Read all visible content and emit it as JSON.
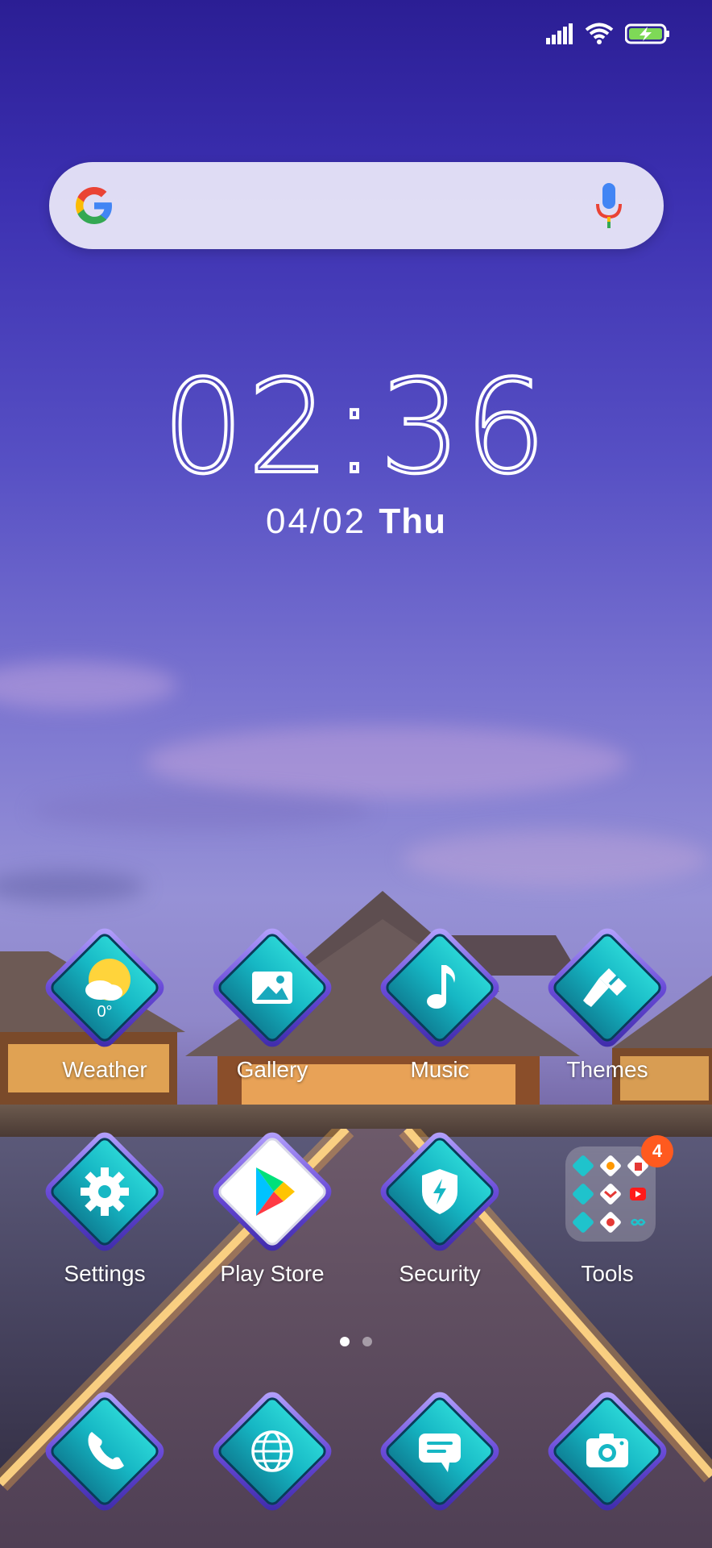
{
  "status_bar": {
    "signal_icon": "signal-icon",
    "wifi_icon": "wifi-icon",
    "battery_icon": "battery-charging-icon",
    "battery_color": "#7ed957"
  },
  "search": {
    "logo_icon": "google-g-icon",
    "mic_icon": "microphone-icon"
  },
  "clock": {
    "time": "02:36",
    "date": "04/02",
    "weekday": "Thu"
  },
  "apps": {
    "weather": {
      "label": "Weather",
      "temp": "0°"
    },
    "gallery": {
      "label": "Gallery"
    },
    "music": {
      "label": "Music"
    },
    "themes": {
      "label": "Themes"
    },
    "settings": {
      "label": "Settings"
    },
    "play_store": {
      "label": "Play Store"
    },
    "security": {
      "label": "Security"
    },
    "tools": {
      "label": "Tools",
      "badge": "4"
    }
  },
  "page_indicator": {
    "pages": 2,
    "current": 1
  },
  "dock": {
    "items": [
      "phone-icon",
      "browser-icon",
      "messages-icon",
      "camera-icon"
    ]
  },
  "colors": {
    "icon_teal": "#1fc3cc",
    "icon_frame": "#7a5be6",
    "badge": "#ff5a1f"
  }
}
